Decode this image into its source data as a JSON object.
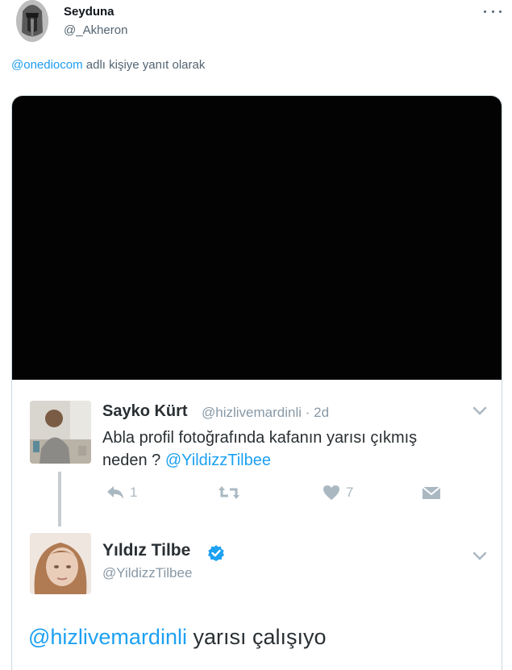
{
  "tweet": {
    "display_name": "Seyduna",
    "handle": "@_Akheron",
    "reply_mention": "@onediocom",
    "reply_suffix": " adlı kişiye yanıt olarak"
  },
  "embedded": {
    "first": {
      "name": "Sayko Kürt",
      "handle_time": "@hizlivemardinli · 2d",
      "text_line1": "Abla profil fotoğrafında kafanın yarısı çıkmış",
      "text_line2": "neden ? ",
      "mention": "@YildizzTilbee",
      "reply_count": "1",
      "like_count": "7"
    },
    "second": {
      "name": "Yıldız Tilbe",
      "handle": "@YildizzTilbee",
      "mention": "@hizlivemardinli",
      "text": " yarısı çalışıyo"
    }
  },
  "colors": {
    "link": "#1d9bf0",
    "verified": "#1da1f2",
    "muted": "#536471",
    "icon_gray": "#aab8c2"
  }
}
